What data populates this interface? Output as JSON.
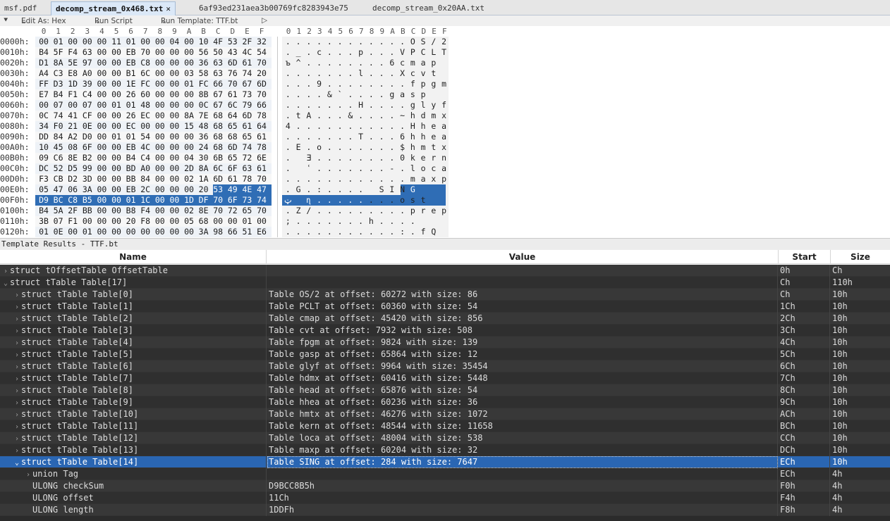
{
  "tabs": [
    {
      "label": "msf.pdf",
      "active": false
    },
    {
      "label": "decomp_stream_0x468.txt",
      "active": true
    },
    {
      "label": "6af93ed231aea3b00769fc8283943e75",
      "active": false
    },
    {
      "label": "decomp_stream_0x20AA.txt",
      "active": false
    }
  ],
  "toolbar": {
    "edit_as": "Edit As: Hex",
    "run_script": "Run Script",
    "run_template": "Run Template: TTF.bt"
  },
  "hex_header": [
    "0",
    "1",
    "2",
    "3",
    "4",
    "5",
    "6",
    "7",
    "8",
    "9",
    "A",
    "B",
    "C",
    "D",
    "E",
    "F"
  ],
  "ascii_header": "0123456789ABCDEF",
  "hex_rows": [
    {
      "addr": "0000h:",
      "bytes": [
        "00",
        "01",
        "00",
        "00",
        "00",
        "11",
        "01",
        "00",
        "00",
        "04",
        "00",
        "10",
        "4F",
        "53",
        "2F",
        "32"
      ],
      "ascii": "............OS/2"
    },
    {
      "addr": "0010h:",
      "bytes": [
        "B4",
        "5F",
        "F4",
        "63",
        "00",
        "00",
        "EB",
        "70",
        "00",
        "00",
        "00",
        "56",
        "50",
        "43",
        "4C",
        "54"
      ],
      "ascii": "._.c...p...VPCLT"
    },
    {
      "addr": "0020h:",
      "bytes": [
        "D1",
        "8A",
        "5E",
        "97",
        "00",
        "00",
        "EB",
        "C8",
        "00",
        "00",
        "00",
        "36",
        "63",
        "6D",
        "61",
        "70"
      ],
      "ascii": "ъ^........6cmap"
    },
    {
      "addr": "0030h:",
      "bytes": [
        "A4",
        "C3",
        "E8",
        "A0",
        "00",
        "00",
        "B1",
        "6C",
        "00",
        "00",
        "03",
        "58",
        "63",
        "76",
        "74",
        "20"
      ],
      "ascii": ".......l...Xcvt "
    },
    {
      "addr": "0040h:",
      "bytes": [
        "FF",
        "D3",
        "1D",
        "39",
        "00",
        "00",
        "1E",
        "FC",
        "00",
        "00",
        "01",
        "FC",
        "66",
        "70",
        "67",
        "6D"
      ],
      "ascii": "...9........fpgm"
    },
    {
      "addr": "0050h:",
      "bytes": [
        "E7",
        "B4",
        "F1",
        "C4",
        "00",
        "00",
        "26",
        "60",
        "00",
        "00",
        "00",
        "8B",
        "67",
        "61",
        "73",
        "70"
      ],
      "ascii": "....&`....gasp"
    },
    {
      "addr": "0060h:",
      "bytes": [
        "00",
        "07",
        "00",
        "07",
        "00",
        "01",
        "01",
        "48",
        "00",
        "00",
        "00",
        "0C",
        "67",
        "6C",
        "79",
        "66"
      ],
      "ascii": ".......H....glyf"
    },
    {
      "addr": "0070h:",
      "bytes": [
        "0C",
        "74",
        "41",
        "CF",
        "00",
        "00",
        "26",
        "EC",
        "00",
        "00",
        "8A",
        "7E",
        "68",
        "64",
        "6D",
        "78"
      ],
      "ascii": ".tA...&....~hdmx"
    },
    {
      "addr": "0080h:",
      "bytes": [
        "34",
        "F0",
        "21",
        "0E",
        "00",
        "00",
        "EC",
        "00",
        "00",
        "00",
        "15",
        "48",
        "68",
        "65",
        "61",
        "64"
      ],
      "ascii": "4...........Hhead"
    },
    {
      "addr": "0090h:",
      "bytes": [
        "DD",
        "84",
        "A2",
        "D0",
        "00",
        "01",
        "01",
        "54",
        "00",
        "00",
        "00",
        "36",
        "68",
        "68",
        "65",
        "61"
      ],
      "ascii": ".......T...6hhea"
    },
    {
      "addr": "00A0h:",
      "bytes": [
        "10",
        "45",
        "08",
        "6F",
        "00",
        "00",
        "EB",
        "4C",
        "00",
        "00",
        "00",
        "24",
        "68",
        "6D",
        "74",
        "78"
      ],
      "ascii": ".E.o.......$hmtx"
    },
    {
      "addr": "00B0h:",
      "bytes": [
        "09",
        "C6",
        "8E",
        "B2",
        "00",
        "00",
        "B4",
        "C4",
        "00",
        "00",
        "04",
        "30",
        "6B",
        "65",
        "72",
        "6E"
      ],
      "ascii": ". Ǝ........0kern"
    },
    {
      "addr": "00C0h:",
      "bytes": [
        "DC",
        "52",
        "D5",
        "99",
        "00",
        "00",
        "BD",
        "A0",
        "00",
        "00",
        "2D",
        "8A",
        "6C",
        "6F",
        "63",
        "61"
      ],
      "ascii": ". ʿ.......-.loca"
    },
    {
      "addr": "00D0h:",
      "bytes": [
        "F3",
        "CB",
        "D2",
        "3D",
        "00",
        "00",
        "BB",
        "84",
        "00",
        "00",
        "02",
        "1A",
        "6D",
        "61",
        "78",
        "70"
      ],
      "ascii": "............maxp"
    },
    {
      "addr": "00E0h:",
      "bytes": [
        "05",
        "47",
        "06",
        "3A",
        "00",
        "00",
        "EB",
        "2C",
        "00",
        "00",
        "00",
        "20",
        "53",
        "49",
        "4E",
        "47"
      ],
      "ascii": ".G.:.... SING"
    },
    {
      "addr": "00F0h:",
      "bytes": [
        "D9",
        "BC",
        "C8",
        "B5",
        "00",
        "00",
        "01",
        "1C",
        "00",
        "00",
        "1D",
        "DF",
        "70",
        "6F",
        "73",
        "74"
      ],
      "ascii": "ټ ɳ........ost"
    },
    {
      "addr": "0100h:",
      "bytes": [
        "B4",
        "5A",
        "2F",
        "BB",
        "00",
        "00",
        "B8",
        "F4",
        "00",
        "00",
        "02",
        "8E",
        "70",
        "72",
        "65",
        "70"
      ],
      "ascii": ".Z/.........prep"
    },
    {
      "addr": "0110h:",
      "bytes": [
        "3B",
        "07",
        "F1",
        "00",
        "00",
        "00",
        "20",
        "F8",
        "00",
        "00",
        "05",
        "68",
        "00",
        "00",
        "01",
        "00"
      ],
      "ascii": ";.......h...."
    },
    {
      "addr": "0120h:",
      "bytes": [
        "01",
        "0E",
        "00",
        "01",
        "00",
        "00",
        "00",
        "00",
        "00",
        "00",
        "00",
        "3A",
        "98",
        "66",
        "51",
        "E6"
      ],
      "ascii": "...........:.fQ"
    }
  ],
  "results_title": "Template Results - TTF.bt",
  "columns": {
    "name": "Name",
    "value": "Value",
    "start": "Start",
    "size": "Size"
  },
  "results": [
    {
      "name": "struct tOffsetTable OffsetTable",
      "value": "",
      "start": "0h",
      "size": "Ch",
      "arrow": "›",
      "indent": 0
    },
    {
      "name": "struct tTable Table[17]",
      "value": "",
      "start": "Ch",
      "size": "110h",
      "arrow": "⌄",
      "indent": 0
    },
    {
      "name": "struct tTable Table[0]",
      "value": "Table OS/2 at offset: 60272 with size: 86",
      "start": "Ch",
      "size": "10h",
      "arrow": "›",
      "indent": 1
    },
    {
      "name": "struct tTable Table[1]",
      "value": "Table PCLT at offset: 60360 with size: 54",
      "start": "1Ch",
      "size": "10h",
      "arrow": "›",
      "indent": 1
    },
    {
      "name": "struct tTable Table[2]",
      "value": "Table cmap at offset: 45420 with size: 856",
      "start": "2Ch",
      "size": "10h",
      "arrow": "›",
      "indent": 1
    },
    {
      "name": "struct tTable Table[3]",
      "value": "Table cvt  at offset: 7932 with size: 508",
      "start": "3Ch",
      "size": "10h",
      "arrow": "›",
      "indent": 1
    },
    {
      "name": "struct tTable Table[4]",
      "value": "Table fpgm at offset: 9824 with size: 139",
      "start": "4Ch",
      "size": "10h",
      "arrow": "›",
      "indent": 1
    },
    {
      "name": "struct tTable Table[5]",
      "value": "Table gasp at offset: 65864 with size: 12",
      "start": "5Ch",
      "size": "10h",
      "arrow": "›",
      "indent": 1
    },
    {
      "name": "struct tTable Table[6]",
      "value": "Table glyf at offset: 9964 with size: 35454",
      "start": "6Ch",
      "size": "10h",
      "arrow": "›",
      "indent": 1
    },
    {
      "name": "struct tTable Table[7]",
      "value": "Table hdmx at offset: 60416 with size: 5448",
      "start": "7Ch",
      "size": "10h",
      "arrow": "›",
      "indent": 1
    },
    {
      "name": "struct tTable Table[8]",
      "value": "Table head at offset: 65876 with size: 54",
      "start": "8Ch",
      "size": "10h",
      "arrow": "›",
      "indent": 1
    },
    {
      "name": "struct tTable Table[9]",
      "value": "Table hhea at offset: 60236 with size: 36",
      "start": "9Ch",
      "size": "10h",
      "arrow": "›",
      "indent": 1
    },
    {
      "name": "struct tTable Table[10]",
      "value": "Table hmtx at offset: 46276 with size: 1072",
      "start": "ACh",
      "size": "10h",
      "arrow": "›",
      "indent": 1
    },
    {
      "name": "struct tTable Table[11]",
      "value": "Table kern at offset: 48544 with size: 11658",
      "start": "BCh",
      "size": "10h",
      "arrow": "›",
      "indent": 1
    },
    {
      "name": "struct tTable Table[12]",
      "value": "Table loca at offset: 48004 with size: 538",
      "start": "CCh",
      "size": "10h",
      "arrow": "›",
      "indent": 1
    },
    {
      "name": "struct tTable Table[13]",
      "value": "Table maxp at offset: 60204 with size: 32",
      "start": "DCh",
      "size": "10h",
      "arrow": "›",
      "indent": 1
    },
    {
      "name": "struct tTable Table[14]",
      "value": "Table SING at offset: 284 with size: 7647",
      "start": "ECh",
      "size": "10h",
      "arrow": "⌄",
      "indent": 1,
      "selected": true
    },
    {
      "name": "union Tag",
      "value": "",
      "start": "ECh",
      "size": "4h",
      "arrow": "›",
      "indent": 2
    },
    {
      "name": "ULONG checkSum",
      "value": "D9BCC8B5h",
      "start": "F0h",
      "size": "4h",
      "arrow": "",
      "indent": 2
    },
    {
      "name": "ULONG offset",
      "value": "11Ch",
      "start": "F4h",
      "size": "4h",
      "arrow": "",
      "indent": 2
    },
    {
      "name": "ULONG length",
      "value": "1DDFh",
      "start": "F8h",
      "size": "4h",
      "arrow": "",
      "indent": 2
    }
  ],
  "colors": {
    "selection": "#2f6db5",
    "dark_bg": "#2b2b2b",
    "row_even": "#383838",
    "row_odd": "#2f2f2f"
  }
}
